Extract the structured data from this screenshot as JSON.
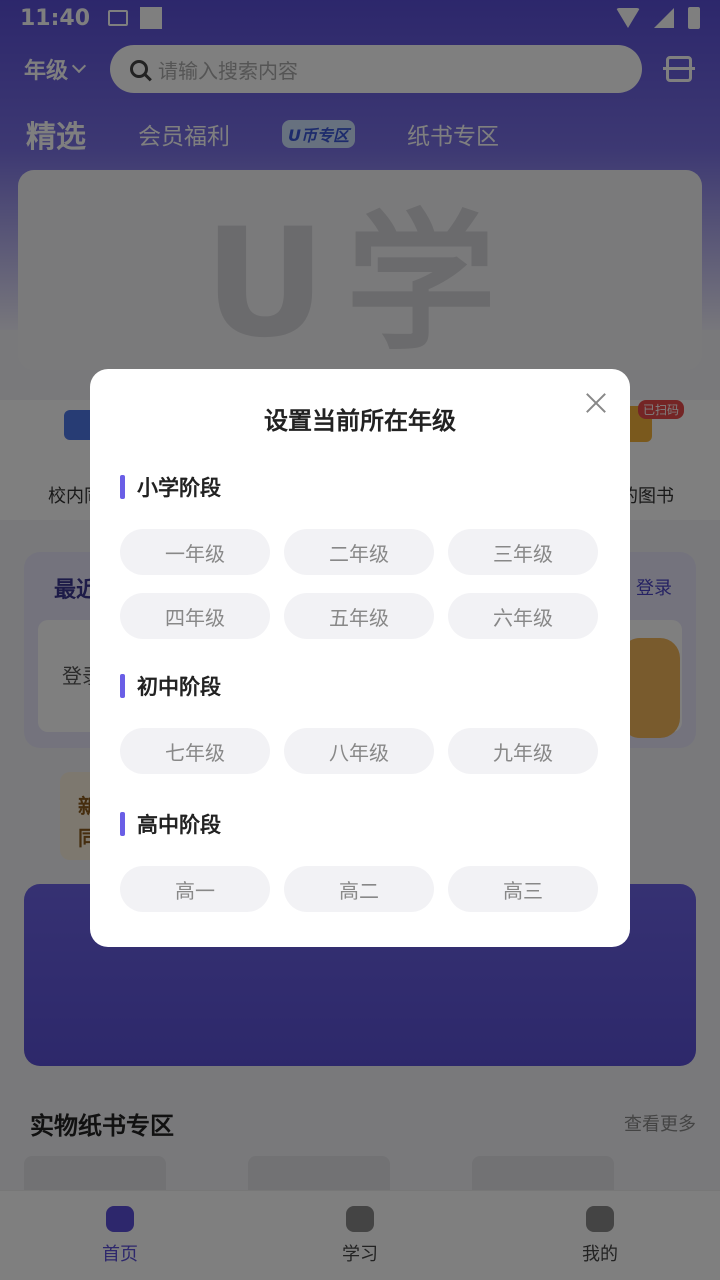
{
  "status_bar": {
    "time": "11:40"
  },
  "header": {
    "grade_selector": "年级",
    "search_placeholder": "请输入搜索内容"
  },
  "tabs": [
    {
      "label": "精选"
    },
    {
      "label": "会员福利"
    },
    {
      "label": "U币专区"
    },
    {
      "label": "纸书专区"
    }
  ],
  "banner": {
    "logo_text": "U学"
  },
  "quick_entries": {
    "left_label": "校内同",
    "right_label": "的图书",
    "right_badge": "已扫码"
  },
  "recent": {
    "title": "最近",
    "link": "登录",
    "inner_text": "登录"
  },
  "new_card": {
    "line1": "新",
    "line2": "同"
  },
  "section": {
    "title": "实物纸书专区",
    "more": "查看更多"
  },
  "bottom_nav": [
    {
      "label": "首页",
      "icon": "home-icon"
    },
    {
      "label": "学习",
      "icon": "study-icon"
    },
    {
      "label": "我的",
      "icon": "profile-icon"
    }
  ],
  "modal": {
    "title": "设置当前所在年级",
    "stages": [
      {
        "label": "小学阶段",
        "grades": [
          "一年级",
          "二年级",
          "三年级",
          "四年级",
          "五年级",
          "六年级"
        ]
      },
      {
        "label": "初中阶段",
        "grades": [
          "七年级",
          "八年级",
          "九年级"
        ]
      },
      {
        "label": "高中阶段",
        "grades": [
          "高一",
          "高二",
          "高三"
        ]
      }
    ]
  },
  "colors": {
    "accent": "#5a4fd8",
    "stage_bar": "#6a5ee6",
    "overlay": "rgba(0,0,0,0.5)"
  }
}
